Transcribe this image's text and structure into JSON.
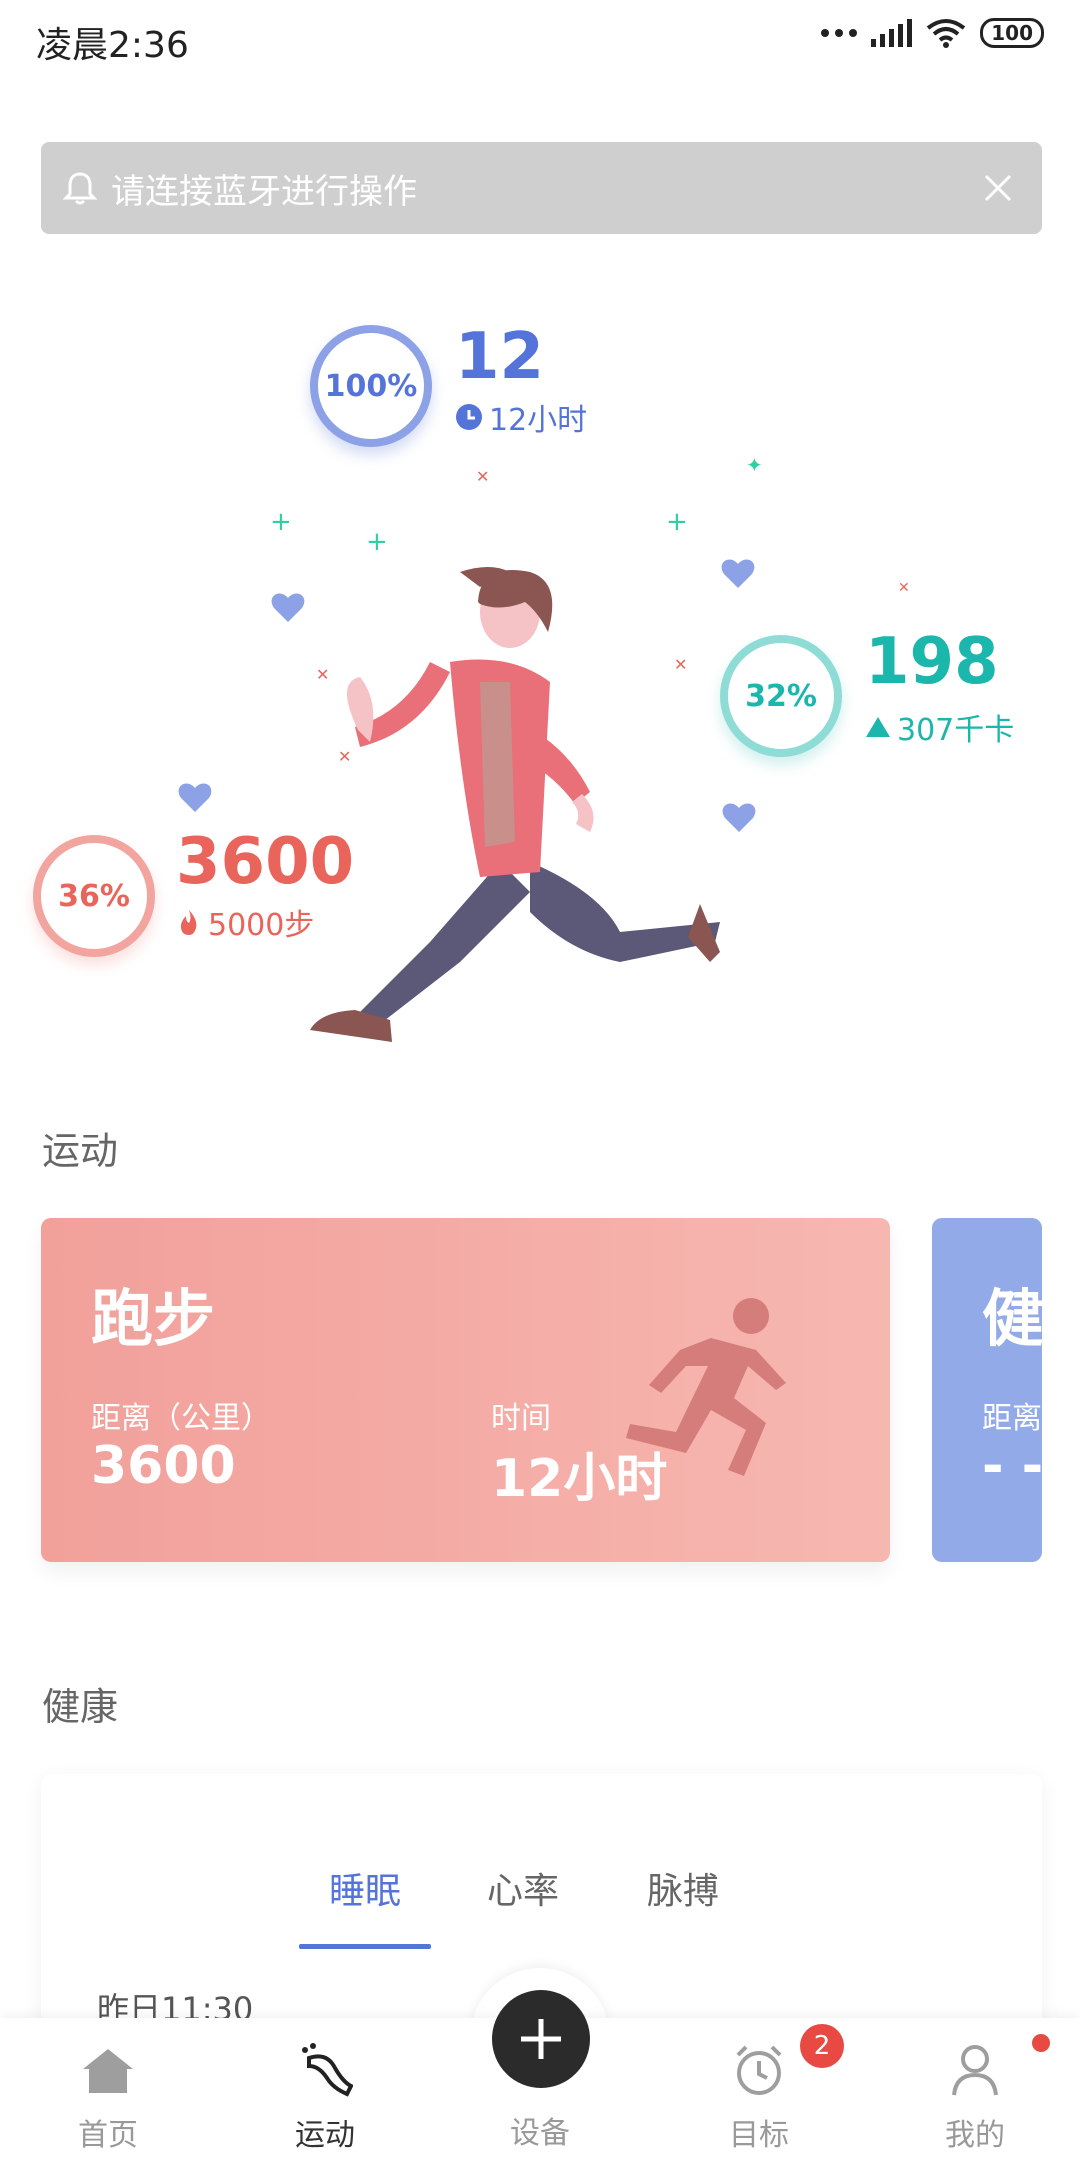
{
  "status_bar": {
    "time": "凌晨2:36",
    "battery": "100"
  },
  "notice": {
    "text": "请连接蓝牙进行操作"
  },
  "hero": {
    "sleep": {
      "percent": "100%",
      "value": "12",
      "detail": "12小时"
    },
    "calories": {
      "percent": "32%",
      "value": "198",
      "detail": "307千卡"
    },
    "steps": {
      "percent": "36%",
      "value": "3600",
      "detail": "5000步"
    }
  },
  "sections": {
    "sport": "运动",
    "health": "健康"
  },
  "sport_cards": [
    {
      "title": "跑步",
      "distance_label": "距离（公里）",
      "distance_value": "3600",
      "time_label": "时间",
      "time_value": "12小时"
    },
    {
      "title": "健",
      "distance_label": "距离",
      "distance_value": "- -"
    }
  ],
  "health": {
    "tabs": [
      "睡眠",
      "心率",
      "脉搏"
    ],
    "active_tab": 0,
    "record_time": "昨日11:30"
  },
  "nav": {
    "items": [
      "首页",
      "运动",
      "设备",
      "目标",
      "我的"
    ],
    "active": 1,
    "goal_badge": "2"
  },
  "colors": {
    "blue": "#5574d9",
    "teal": "#1bb6ac",
    "red": "#e9655b",
    "run_card": "#f2a09a",
    "fit_card": "#93aae8"
  }
}
